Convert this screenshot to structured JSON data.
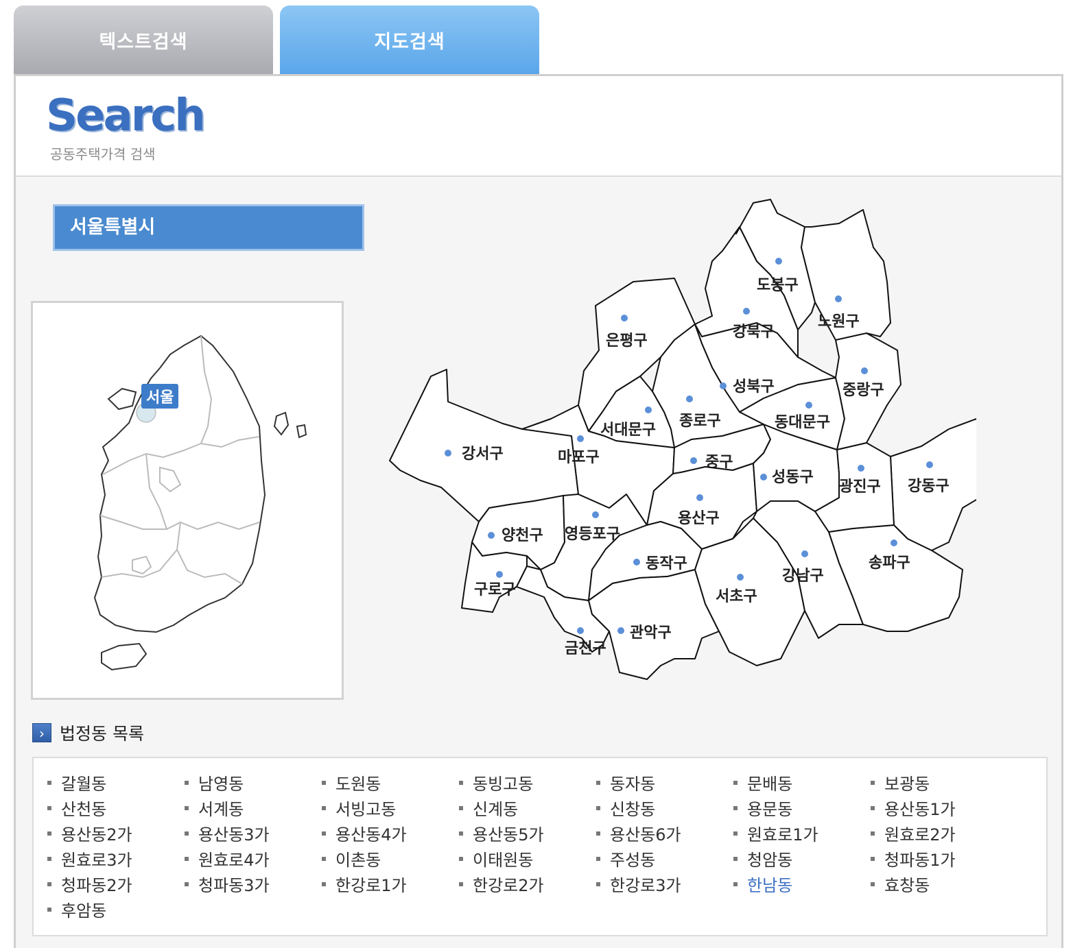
{
  "tabs": {
    "text_search": "텍스트검색",
    "map_search": "지도검색"
  },
  "header": {
    "logo": "Search",
    "subtitle": "공동주택가격 검색"
  },
  "region": {
    "selected": "서울특별시"
  },
  "mini_map": {
    "seoul_label": "서울"
  },
  "districts": [
    "강서구",
    "양천구",
    "구로구",
    "금천구",
    "영등포구",
    "마포구",
    "은평구",
    "서대문구",
    "종로구",
    "중구",
    "용산구",
    "동작구",
    "관악구",
    "서초구",
    "강남구",
    "송파구",
    "강동구",
    "광진구",
    "성동구",
    "동대문구",
    "중랑구",
    "성북구",
    "강북구",
    "도봉구",
    "노원구"
  ],
  "list": {
    "title": "법정동 목록",
    "items": [
      "갈월동",
      "남영동",
      "도원동",
      "동빙고동",
      "동자동",
      "문배동",
      "보광동",
      "산천동",
      "서계동",
      "서빙고동",
      "신계동",
      "신창동",
      "용문동",
      "용산동1가",
      "용산동2가",
      "용산동3가",
      "용산동4가",
      "용산동5가",
      "용산동6가",
      "원효로1가",
      "원효로2가",
      "원효로3가",
      "원효로4가",
      "이촌동",
      "이태원동",
      "주성동",
      "청암동",
      "청파동1가",
      "청파동2가",
      "청파동3가",
      "한강로1가",
      "한강로2가",
      "한강로3가",
      "한남동",
      "효창동",
      "후암동"
    ],
    "highlighted": "한남동"
  },
  "colors": {
    "tab_active": "#5aa6ea",
    "tab_inactive": "#a9aab0",
    "region_bar": "#4a8ad0",
    "dot": "#5b8fd8",
    "highlight_link": "#3d6fc3"
  }
}
